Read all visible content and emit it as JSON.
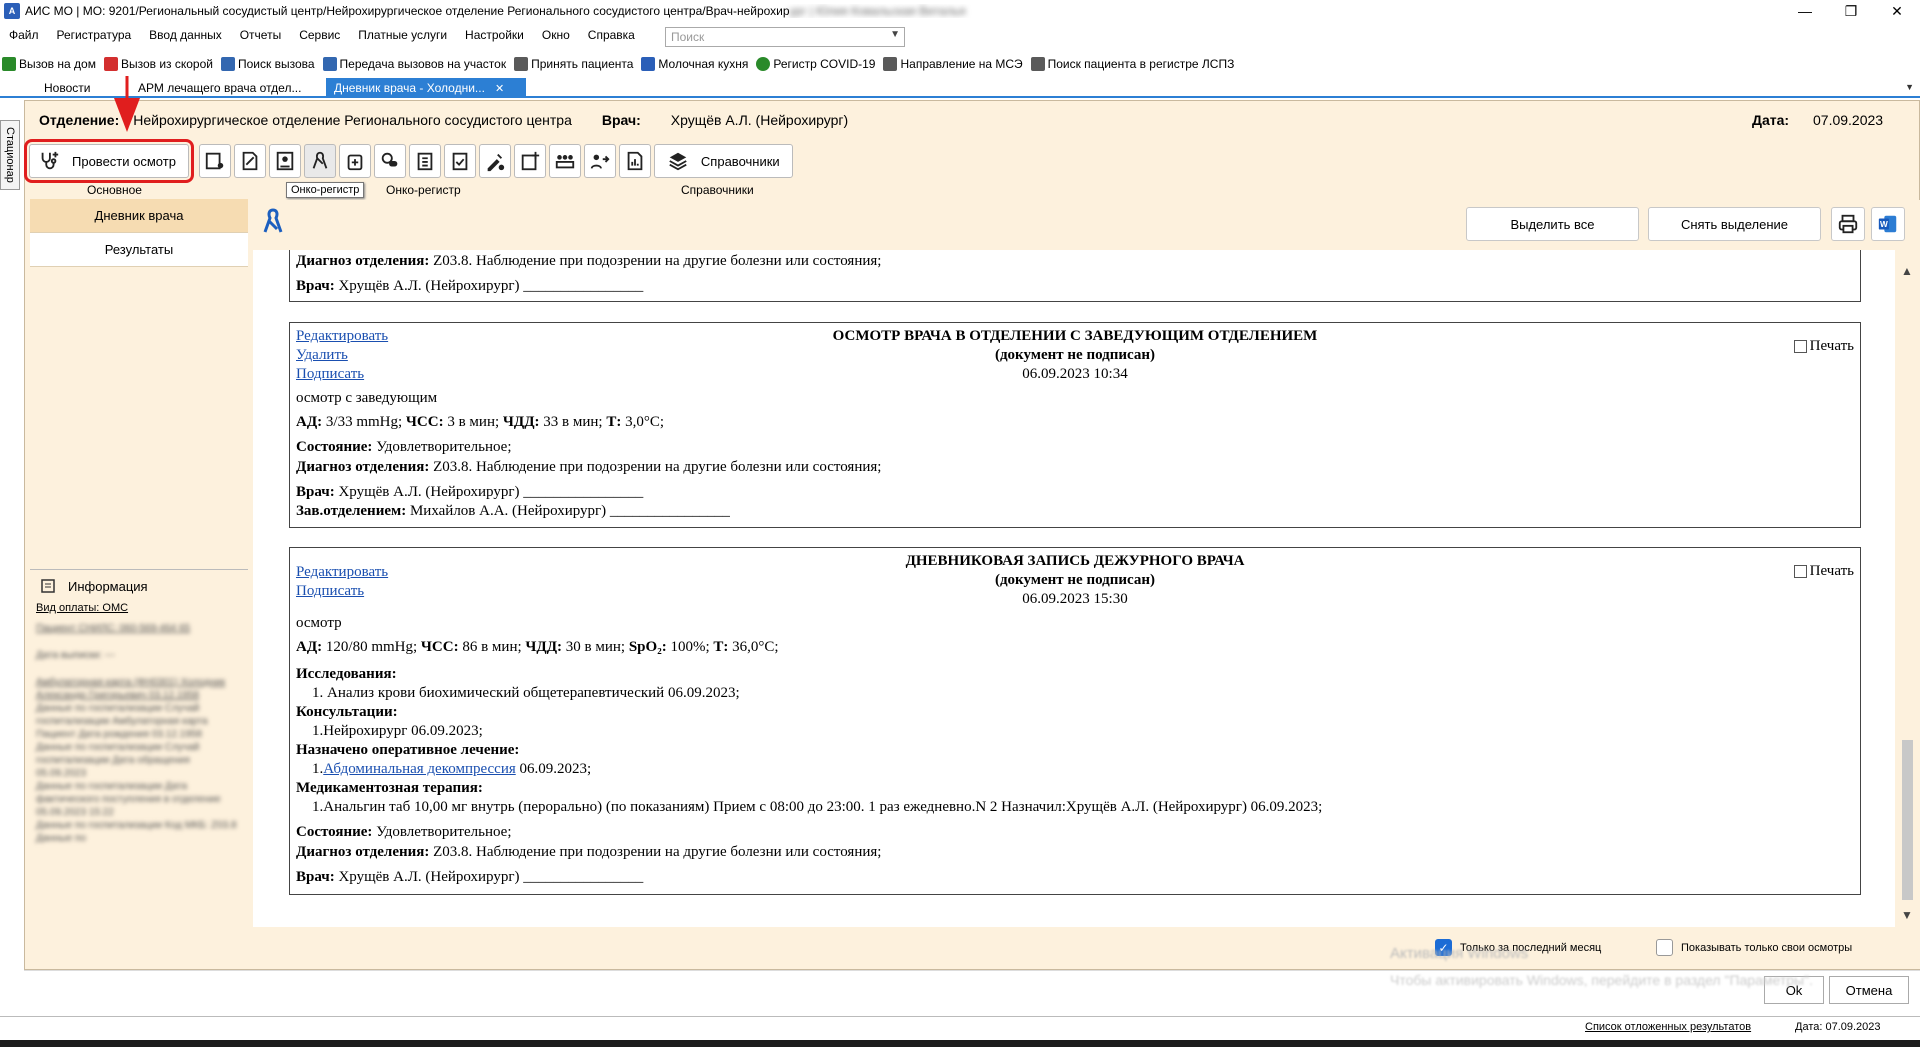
{
  "titlebar": {
    "title": "АИС МО | МО: 9201/Региональный сосудистый центр/Нейрохирургическое отделение Регионального сосудистого центра/Врач-нейрохир",
    "title_blurred": "ург | Юлия Ковальская Виталья",
    "minimize": "—",
    "maximize": "❐",
    "close": "✕"
  },
  "menu": [
    "Файл",
    "Регистратура",
    "Ввод данных",
    "Отчеты",
    "Сервис",
    "Платные услуги",
    "Настройки",
    "Окно",
    "Справка"
  ],
  "search": {
    "placeholder": "Поиск"
  },
  "quickbar": [
    {
      "label": "Вызов на дом",
      "color": "#2a8a2a"
    },
    {
      "label": "Вызов из скорой",
      "color": "#d32f2f"
    },
    {
      "label": "Поиск вызова",
      "color": "#3367b0"
    },
    {
      "label": "Передача вызовов на участок",
      "color": "#3367b0"
    },
    {
      "label": "Принять пациента",
      "color": "#5a5a5a"
    },
    {
      "label": "Молочная кухня",
      "color": "#2b5fb8"
    },
    {
      "label": "Регистр COVID-19",
      "color": "#2a8a2a"
    },
    {
      "label": "Направление на МСЭ",
      "color": "#5a5a5a"
    },
    {
      "label": "Поиск пациента в регистре ЛСПЗ",
      "color": "#5a5a5a"
    }
  ],
  "tabs": {
    "news": "Новости",
    "arm": "АРМ лечащего врача отдел...",
    "diary": "Дневник врача - Холодни...",
    "close": "✕"
  },
  "side_label": "Стационар",
  "header": {
    "dept_label": "Отделение:",
    "dept_value": "Нейрохирургическое отделение Регионального сосудистого центра",
    "doctor_label": "Врач:",
    "doctor_value": "Хрущёв А.Л. (Нейрохирург)",
    "date_label": "Дата:",
    "date_value": "07.09.2023"
  },
  "toolbar": {
    "exam_button": "Провести осмотр",
    "refs_button": "Справочники",
    "group_main": "Основное",
    "group_onco": "Онко-регистр",
    "group_refs": "Справочники",
    "tooltip": "Онко-регистр"
  },
  "left_nav": {
    "diary": "Дневник врача",
    "results": "Результаты"
  },
  "info": {
    "title": "Информация",
    "payment": "Вид оплаты: ОМС",
    "blurred": [
      "Пациент СНИЛС: 060-569-464 65",
      "Дата выписки: ---",
      "Амбулаторная карта (ФН0301) Холодник Александр Григорьевич 03.12.1958",
      "Данные по госпитализации Случай госпитализации Амбулаторная карта Пациент Дата рождения 03.12.1958",
      "Данные по госпитализации Случай госпитализации Дата обращения 05.09.2023",
      "Данные по госпитализации Дата фактического поступления в отделение 05.09.2023 15:22",
      "Данные по госпитализации Код МКБ: Z03.8",
      "Данные по"
    ]
  },
  "content_buttons": {
    "select_all": "Выделить все",
    "deselect": "Снять выделение"
  },
  "records": {
    "r0": {
      "diag_label": "Диагноз отделения:",
      "diag_value": " Z03.8. Наблюдение при подозрении на другие болезни или состояния;",
      "doc_label": "Врач:",
      "doc_value": " Хрущёв А.Л. (Нейрохирург) ________________"
    },
    "r1": {
      "edit": "Редактировать",
      "delete": "Удалить",
      "sign": "Подписать",
      "title": "ОСМОТР ВРАЧА В ОТДЕЛЕНИИ С ЗАВЕДУЮЩИМ ОТДЕЛЕНИЕМ",
      "status": "(документ не подписан)",
      "datetime": "06.09.2023 10:34",
      "print": "Печать",
      "text": "осмотр с заведующим",
      "ad_label": "АД:",
      "ad_value": " 3/33 mmHg; ",
      "hr_label": "ЧСС:",
      "hr_value": " 3 в мин; ",
      "rr_label": "ЧДД:",
      "rr_value": " 33 в мин; ",
      "t_label": "Т:",
      "t_value": " 3,0°С;",
      "state_label": "Состояние:",
      "state_value": " Удовлетворительное;",
      "diag_label": "Диагноз отделения:",
      "diag_value": " Z03.8. Наблюдение при подозрении на другие болезни или состояния;",
      "doc_label": "Врач:",
      "doc_value": " Хрущёв А.Л. (Нейрохирург) ________________",
      "head_label": "Зав.отделением:",
      "head_value": " Михайлов А.А. (Нейрохирург) ________________"
    },
    "r2": {
      "edit": "Редактировать",
      "sign": "Подписать",
      "title": "ДНЕВНИКОВАЯ ЗАПИСЬ ДЕЖУРНОГО ВРАЧА",
      "status": "(документ не подписан)",
      "datetime": "06.09.2023 15:30",
      "print": "Печать",
      "text": "осмотр",
      "ad_label": "АД:",
      "ad_value": " 120/80 mmHg; ",
      "hr_label": "ЧСС:",
      "hr_value": " 86 в мин; ",
      "rr_label": "ЧДД:",
      "rr_value": " 30 в мин; ",
      "spo_label": "SpO₂:",
      "spo_value": " 100%; ",
      "t_label": "Т:",
      "t_value": " 36,0°С;",
      "research_label": "Исследования:",
      "research_item": "1. Анализ крови биохимический общетерапевтический 06.09.2023;",
      "consult_label": "Консультации:",
      "consult_item": "1.Нейрохирург 06.09.2023;",
      "surgery_label": "Назначено оперативное лечение:",
      "surgery_num": "1.",
      "surgery_link": "Абдоминальная декомпрессия",
      "surgery_date": " 06.09.2023;",
      "med_label": "Медикаментозная терапия:",
      "med_item": "1.Анальгин таб 10,00 мг внутрь (перорально) (по показаниям) Прием с 08:00 до 23:00. 1 раз ежедневно.N 2 Назначил:Хрущёв А.Л. (Нейрохирург) 06.09.2023;",
      "state_label": "Состояние:",
      "state_value": " Удовлетворительное;",
      "diag_label": "Диагноз отделения:",
      "diag_value": " Z03.8. Наблюдение при подозрении на другие болезни или состояния;",
      "doc_label": "Врач:",
      "doc_value": " Хрущёв А.Л. (Нейрохирург) ________________"
    }
  },
  "bottom": {
    "last_month": "Только за последний месяц",
    "last_month_checked": true,
    "only_mine": "Показывать только свои осмотры",
    "only_mine_checked": false,
    "ok": "Ok",
    "cancel": "Отмена",
    "watermark1": "Активация Windows",
    "watermark2": "Чтобы активировать Windows, перейдите в раздел \"Параметры\"."
  },
  "status": {
    "deferred": "Список отложенных результатов",
    "date": "Дата: 07.09.2023"
  },
  "colors": {
    "accent": "#2c7fd4",
    "panel_bg": "#fdf1dd",
    "highlight_red": "#e01e1e",
    "link": "#1a4fb0"
  }
}
